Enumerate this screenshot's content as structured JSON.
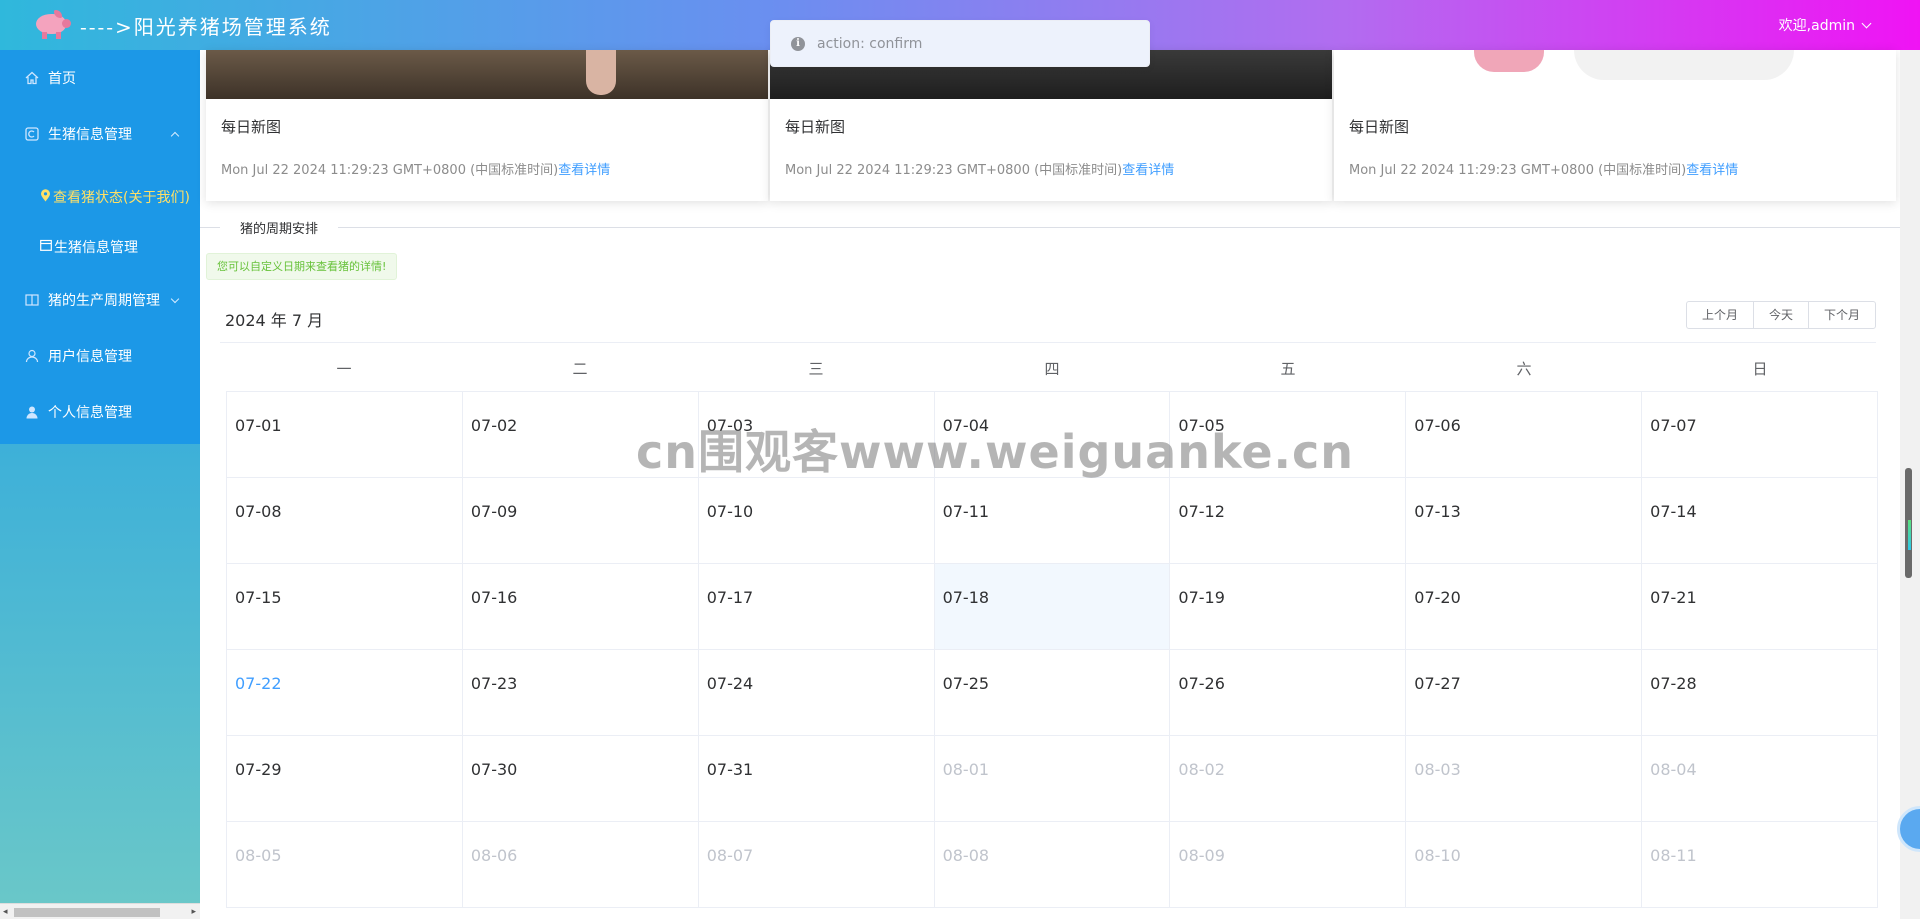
{
  "header": {
    "title": "---->阳光养猪场管理系统",
    "user": "欢迎,admin"
  },
  "sidebar": {
    "items": [
      {
        "label": "首页",
        "icon": "home-icon"
      },
      {
        "label": "生猪信息管理",
        "icon": "c-square-icon",
        "expanded": true
      },
      {
        "label": "查看猪状态(关于我们)",
        "icon": "location-pin-icon",
        "active": true
      },
      {
        "label": "生猪信息管理",
        "icon": "calendar-icon"
      },
      {
        "label": "猪的生产周期管理",
        "icon": "book-icon",
        "expanded": false
      },
      {
        "label": "用户信息管理",
        "icon": "user-icon"
      },
      {
        "label": "个人信息管理",
        "icon": "person-icon"
      }
    ]
  },
  "cards": [
    {
      "title": "每日新图",
      "date": "Mon Jul 22 2024 11:29:23 GMT+0800 (中国标准时间)",
      "link": "查看详情"
    },
    {
      "title": "每日新图",
      "date": "Mon Jul 22 2024 11:29:23 GMT+0800 (中国标准时间)",
      "link": "查看详情"
    },
    {
      "title": "每日新图",
      "date": "Mon Jul 22 2024 11:29:23 GMT+0800 (中国标准时间)",
      "link": "查看详情"
    }
  ],
  "section_title": "猪的周期安排",
  "tip": "您可以自定义日期来查看猪的详情!",
  "calendar": {
    "title": "2024 年 7 月",
    "buttons": {
      "prev": "上个月",
      "today": "今天",
      "next": "下个月"
    },
    "weekdays": [
      "一",
      "二",
      "三",
      "四",
      "五",
      "六",
      "日"
    ],
    "cells": [
      {
        "d": "07-01"
      },
      {
        "d": "07-02"
      },
      {
        "d": "07-03"
      },
      {
        "d": "07-04"
      },
      {
        "d": "07-05"
      },
      {
        "d": "07-06"
      },
      {
        "d": "07-07"
      },
      {
        "d": "07-08"
      },
      {
        "d": "07-09"
      },
      {
        "d": "07-10"
      },
      {
        "d": "07-11"
      },
      {
        "d": "07-12"
      },
      {
        "d": "07-13"
      },
      {
        "d": "07-14"
      },
      {
        "d": "07-15"
      },
      {
        "d": "07-16"
      },
      {
        "d": "07-17"
      },
      {
        "d": "07-18",
        "selected": true
      },
      {
        "d": "07-19"
      },
      {
        "d": "07-20"
      },
      {
        "d": "07-21"
      },
      {
        "d": "07-22",
        "today": true
      },
      {
        "d": "07-23"
      },
      {
        "d": "07-24"
      },
      {
        "d": "07-25"
      },
      {
        "d": "07-26"
      },
      {
        "d": "07-27"
      },
      {
        "d": "07-28"
      },
      {
        "d": "07-29"
      },
      {
        "d": "07-30"
      },
      {
        "d": "07-31"
      },
      {
        "d": "08-01",
        "other": true
      },
      {
        "d": "08-02",
        "other": true
      },
      {
        "d": "08-03",
        "other": true
      },
      {
        "d": "08-04",
        "other": true
      },
      {
        "d": "08-05",
        "other": true
      },
      {
        "d": "08-06",
        "other": true
      },
      {
        "d": "08-07",
        "other": true
      },
      {
        "d": "08-08",
        "other": true
      },
      {
        "d": "08-09",
        "other": true
      },
      {
        "d": "08-10",
        "other": true
      },
      {
        "d": "08-11",
        "other": true
      }
    ]
  },
  "toast": {
    "message": "action: confirm",
    "icon": "info-icon"
  },
  "watermark": "cn围观客www.weiguanke.cn",
  "colors": {
    "accent": "#409eff",
    "sidebar": "#1c98e7",
    "header_start": "#2fb8dc",
    "header_end": "#f013f4"
  }
}
